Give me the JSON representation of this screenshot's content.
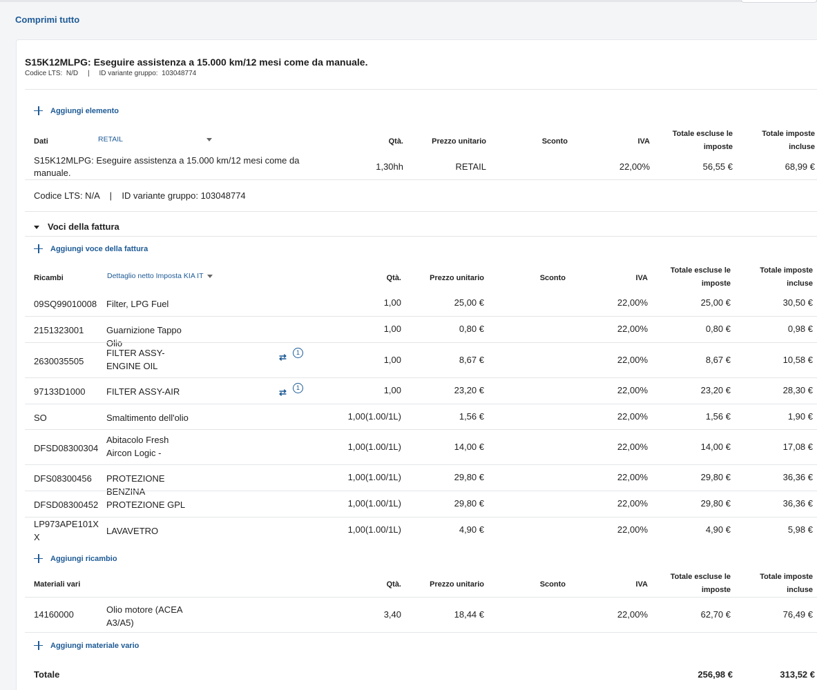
{
  "top": {
    "collapse_all": "Comprimi tutto"
  },
  "header": {
    "title": "S15K12MLPG: Eseguire assistenza a 15.000 km/12 mesi come da manuale.",
    "lts_label": "Codice LTS:",
    "lts_value": "N/D",
    "sep": "|",
    "group_label": "ID variante gruppo:",
    "group_value": "103048774"
  },
  "add_element": "Aggiungi elemento",
  "job": {
    "col_dati": "Dati",
    "price_select": "RETAIL",
    "col_qty": "Qtà.",
    "col_unit": "Prezzo unitario",
    "col_disc": "Sconto",
    "col_vat": "IVA",
    "col_excl": "Totale escluse le imposte",
    "col_incl": "Totale imposte incluse",
    "row": {
      "desc": "S15K12MLPG: Eseguire assistenza a 15.000 km/12 mesi come da manuale.",
      "qty": "1,30hh",
      "unit": "RETAIL",
      "vat": "22,00%",
      "excl": "56,55 €",
      "incl": "68,99 €"
    },
    "info": "Codice LTS: N/A    |    ID variante gruppo: 103048774"
  },
  "invoice": {
    "section_title": "Voci della fattura",
    "add_item": "Aggiungi voce della fattura",
    "parts": {
      "col_code": "Ricambi",
      "detail_select": "Dettaglio netto Imposta KIA IT",
      "col_qty": "Qtà.",
      "col_unit": "Prezzo unitario",
      "col_disc": "Sconto",
      "col_vat": "IVA",
      "col_excl": "Totale escluse le imposte",
      "col_incl": "Totale imposte incluse",
      "rows": [
        {
          "code": "09SQ99010008",
          "desc": "Filter, LPG Fuel",
          "qty": "1,00",
          "unit": "25,00 €",
          "vat": "22,00%",
          "excl": "25,00 €",
          "incl": "30,50 €"
        },
        {
          "code": "2151323001",
          "desc": "Guarnizione Tappo Olio",
          "qty": "1,00",
          "unit": "0,80 €",
          "vat": "22,00%",
          "excl": "0,80 €",
          "incl": "0,98 €"
        },
        {
          "code": "2630035505",
          "desc": "FILTER ASSY-ENGINE OIL",
          "qty": "1,00",
          "unit": "8,67 €",
          "vat": "22,00%",
          "excl": "8,67 €",
          "incl": "10,58 €",
          "sub_count": "1"
        },
        {
          "code": "97133D1000",
          "desc": "FILTER ASSY-AIR",
          "qty": "1,00",
          "unit": "23,20 €",
          "vat": "22,00%",
          "excl": "23,20 €",
          "incl": "28,30 €",
          "sub_count": "1"
        },
        {
          "code": "SO",
          "desc": "Smaltimento dell'olio",
          "qty": "1,00(1.00/1L)",
          "unit": "1,56 €",
          "vat": "22,00%",
          "excl": "1,56 €",
          "incl": "1,90 €"
        },
        {
          "code": "DFSD08300304",
          "desc": "Abitacolo Fresh Aircon Logic -",
          "qty": "1,00(1.00/1L)",
          "unit": "14,00 €",
          "vat": "22,00%",
          "excl": "14,00 €",
          "incl": "17,08 €"
        },
        {
          "code": "DFS08300456",
          "desc": "PROTEZIONE BENZINA",
          "qty": "1,00(1.00/1L)",
          "unit": "29,80 €",
          "vat": "22,00%",
          "excl": "29,80 €",
          "incl": "36,36 €"
        },
        {
          "code": "DFSD08300452",
          "desc": "PROTEZIONE GPL",
          "qty": "1,00(1.00/1L)",
          "unit": "29,80 €",
          "vat": "22,00%",
          "excl": "29,80 €",
          "incl": "36,36 €"
        },
        {
          "code": "LP973APE101XX",
          "desc": "LAVAVETRO",
          "qty": "1,00(1.00/1L)",
          "unit": "4,90 €",
          "vat": "22,00%",
          "excl": "4,90 €",
          "incl": "5,98 €"
        }
      ],
      "add_part": "Aggiungi ricambio"
    },
    "materials": {
      "col_code": "Materiali vari",
      "col_qty": "Qtà.",
      "col_unit": "Prezzo unitario",
      "col_disc": "Sconto",
      "col_vat": "IVA",
      "col_excl": "Totale escluse le imposte",
      "col_incl": "Totale imposte incluse",
      "rows": [
        {
          "code": "14160000",
          "desc": "Olio motore (ACEA A3/A5)",
          "qty": "3,40",
          "unit": "18,44 €",
          "vat": "22,00%",
          "excl": "62,70 €",
          "incl": "76,49 €"
        }
      ],
      "add_material": "Aggiungi materiale vario"
    }
  },
  "total": {
    "label": "Totale",
    "excl": "256,98 €",
    "incl": "313,52 €"
  },
  "colors": {
    "accent": "#1d5a95",
    "divider": "#e3e5e8"
  }
}
